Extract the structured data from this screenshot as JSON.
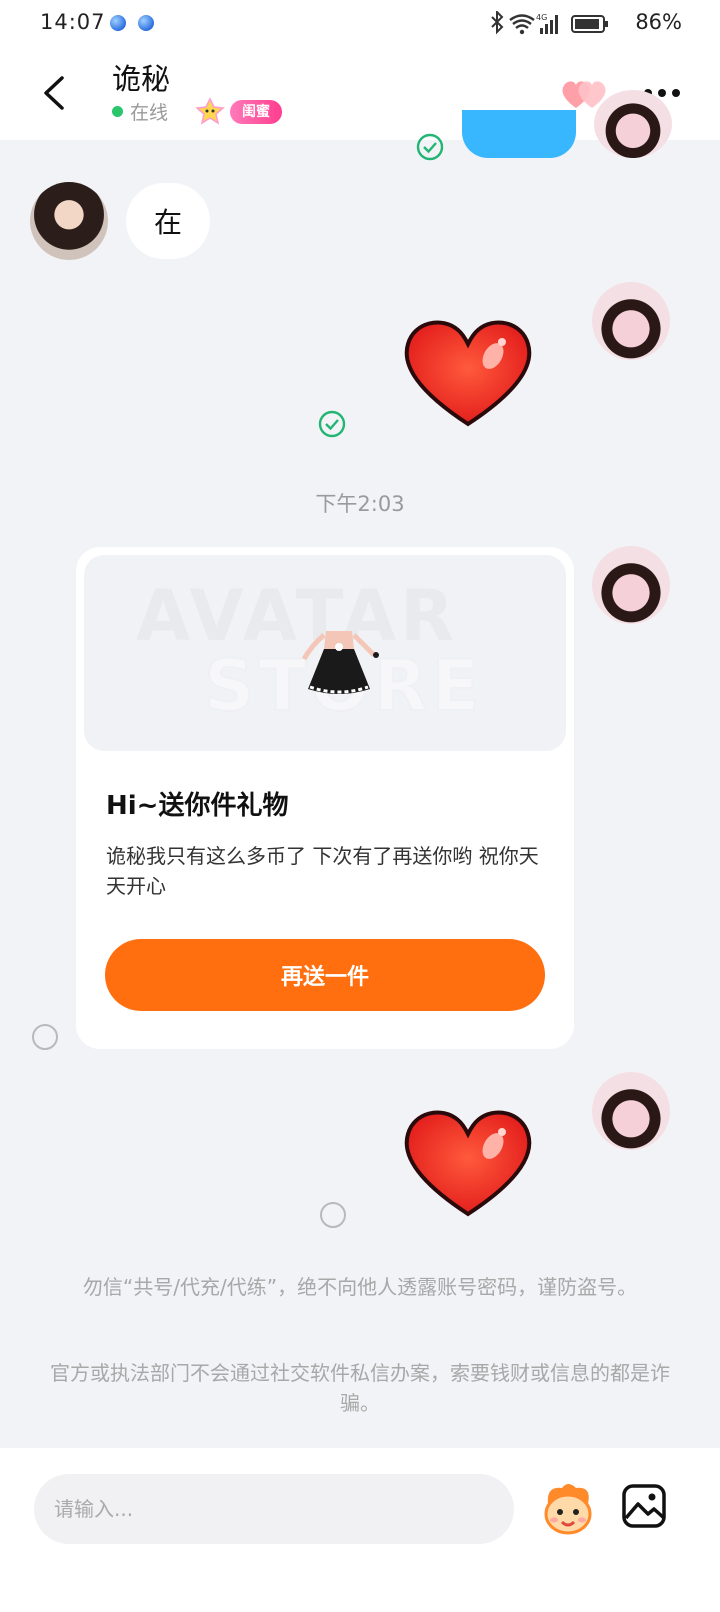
{
  "status_bar": {
    "time": "14:07",
    "battery": "86%"
  },
  "header": {
    "title": "诡秘",
    "status": "在线",
    "relation_badge": "闺蜜"
  },
  "messages": {
    "incoming_text": "在",
    "timestamp": "下午2:03",
    "gift_card": {
      "title": "Hi~送你件礼物",
      "message": "诡秘我只有这么多币了 下次有了再送你哟 祝你天天开心",
      "button": "再送一件",
      "watermark_line1": "AVATAR",
      "watermark_line2": "STORE"
    }
  },
  "notices": [
    "勿信“共号/代充/代练”，绝不向他人透露账号密码，谨防盗号。",
    "官方或执法部门不会通过社交软件私信办案，索要钱财或信息的都是诈骗。"
  ],
  "input": {
    "placeholder": "请输入..."
  },
  "colors": {
    "accent_orange": "#ff6f0f",
    "online_green": "#29c66b",
    "badge_pink": "#ff3d8f",
    "read_check_green": "#22b573"
  }
}
